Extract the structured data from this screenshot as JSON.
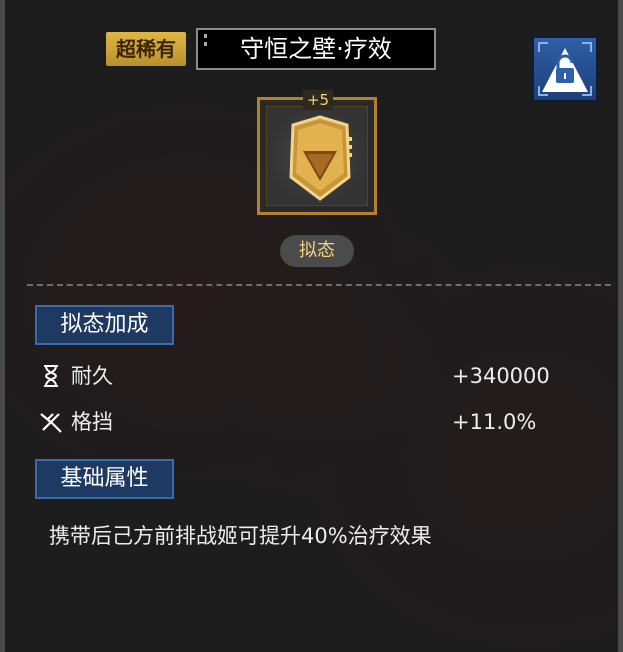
{
  "header": {
    "rarity": "超稀有",
    "title": "守恒之壁·疗效"
  },
  "item": {
    "enhance_level": "+5",
    "form_tag": "拟态"
  },
  "sections": {
    "mimic_bonus": {
      "title": "拟态加成",
      "stats": [
        {
          "icon": "hourglass-icon",
          "label": "耐久",
          "value": "+340000"
        },
        {
          "icon": "block-swords-icon",
          "label": "格挡",
          "value": "+11.0%"
        }
      ]
    },
    "base_attributes": {
      "title": "基础属性",
      "description": "携带后己方前排战姬可提升40%治疗效果"
    }
  },
  "colors": {
    "rarity_gold": "#d4a83a",
    "lock_blue": "#2e5fa8",
    "section_blue": "#1e3a62",
    "frame_bronze": "#b4822e"
  }
}
